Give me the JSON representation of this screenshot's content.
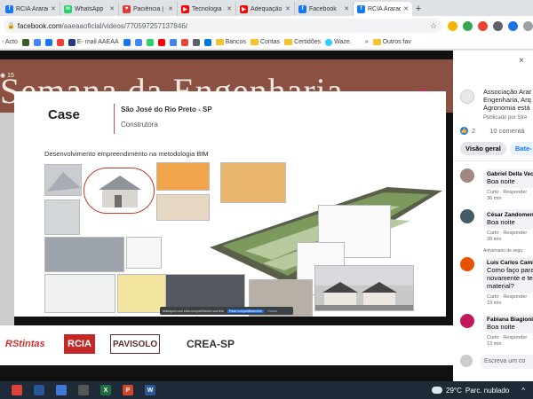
{
  "tabs": [
    {
      "label": "RCIA Araraquara",
      "color": "#1877f2",
      "glyph": "f",
      "active": false
    },
    {
      "label": "WhatsApp",
      "color": "#25d366",
      "glyph": "w",
      "active": false
    },
    {
      "label": "Paciência | jo",
      "color": "#e53935",
      "glyph": "♥",
      "active": false
    },
    {
      "label": "Tecnologia BI",
      "color": "#ff0000",
      "glyph": "▶",
      "active": false
    },
    {
      "label": "Adequação A",
      "color": "#ff0000",
      "glyph": "▶",
      "active": false
    },
    {
      "label": "Facebook",
      "color": "#1877f2",
      "glyph": "f",
      "active": false
    },
    {
      "label": "RCIA Araraqu",
      "color": "#1877f2",
      "glyph": "f",
      "active": true
    }
  ],
  "new_tab": "+",
  "address": {
    "host": "facebook.com",
    "path": "/aaeaaoficial/videos/770597257137846/"
  },
  "bookmarks": {
    "items": [
      {
        "label": "- Acto",
        "color": ""
      },
      {
        "label": "",
        "color": "#3a5e2b"
      },
      {
        "label": "",
        "color": "#4285f4"
      },
      {
        "label": "",
        "color": "#1877f2"
      },
      {
        "label": "",
        "color": "#ea4335"
      },
      {
        "label": "E- mail AAEAA",
        "color": "#1e3a8a"
      },
      {
        "label": "",
        "color": "#1877f2"
      },
      {
        "label": "",
        "color": "#4285f4"
      },
      {
        "label": "",
        "color": "#25d366"
      },
      {
        "label": "",
        "color": "#ff0000"
      },
      {
        "label": "",
        "color": "#4285f4"
      },
      {
        "label": "",
        "color": "#ea4335"
      },
      {
        "label": "",
        "color": "#5f6368"
      },
      {
        "label": "",
        "color": "#0078d4"
      }
    ],
    "folders": [
      "Bancos",
      "Contas",
      "Certidões"
    ],
    "waze": "Waze.",
    "more": "»",
    "other": "Outros fav"
  },
  "video": {
    "banner_title": "Semana da Engenharia",
    "live_count": "15",
    "slide": {
      "case": "Case",
      "city": "São José do Rio Preto - SP",
      "company": "Construtora",
      "dev_text": "Desenvolvimento empreendimento na metodologia BIM"
    },
    "share_bar": {
      "text": "drawsport.com está compartilhando sua tela",
      "stop": "Parar compartilhamento",
      "hide": "Ocultar"
    },
    "sponsors": [
      "RStintas",
      "RCIA",
      "PAVISOLO",
      "CREA-SP"
    ]
  },
  "panel": {
    "close": "×",
    "page_name_lines": [
      "Associação Arar",
      "Engenharia, Arq",
      "Agronomia está"
    ],
    "published": "Publicado por Stre",
    "likes": "2",
    "comments": "10 comentá",
    "tabs": [
      "Visão geral",
      "Bate-"
    ],
    "comment_list": [
      {
        "name": "Gabriel Della Vecc",
        "text": [
          "Boa noite"
        ],
        "actions": "Curtir · Responder",
        "time": "36 min",
        "avatar": "#a1887f",
        "top": ""
      },
      {
        "name": "César Zandomen",
        "text": [
          "Boa noite"
        ],
        "actions": "Curtir · Responder",
        "time": "28 min",
        "avatar": "#455a64",
        "top": ""
      },
      {
        "name": "Luis Carlos Cambi",
        "text": [
          "Como faço para",
          "novamente e te",
          "material?"
        ],
        "actions": "Curtir · Responder",
        "time": "19 min",
        "avatar": "#e65100",
        "top": "Aniversario de segu"
      },
      {
        "name": "Fabiana Biagioni",
        "text": [
          "Boa noite"
        ],
        "actions": "Curtir · Responder",
        "time": "13 min",
        "avatar": "#c2185b",
        "top": ""
      }
    ],
    "write_placeholder": "Escreva um co"
  },
  "taskbar": {
    "apps": [
      {
        "name": "chrome",
        "color": "#db4437",
        "glyph": ""
      },
      {
        "name": "explorer",
        "color": "#2b5797",
        "glyph": ""
      },
      {
        "name": "files",
        "color": "#3d7ad6",
        "glyph": ""
      },
      {
        "name": "calculator",
        "color": "#555",
        "glyph": ""
      },
      {
        "name": "excel",
        "color": "#1d6f42",
        "glyph": "X"
      },
      {
        "name": "powerpoint",
        "color": "#d24726",
        "glyph": "P"
      },
      {
        "name": "word",
        "color": "#2b579a",
        "glyph": "W"
      }
    ],
    "temperature": "29°C",
    "weather": "Parc. nublado",
    "chevron": "^"
  }
}
